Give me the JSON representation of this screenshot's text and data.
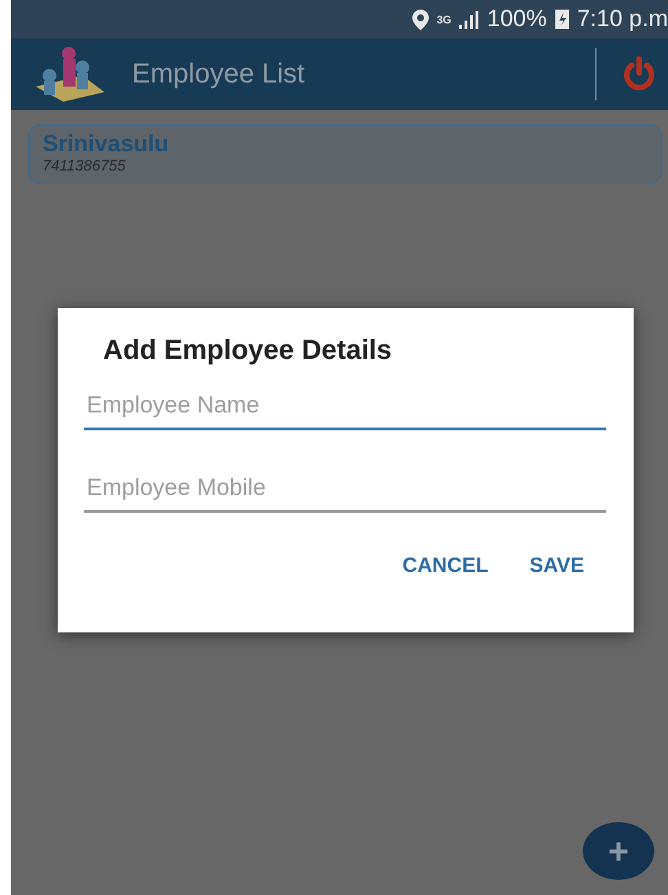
{
  "status_bar": {
    "network": "3G",
    "battery": "100%",
    "time": "7:10 p.m"
  },
  "app_bar": {
    "title": "Employee List"
  },
  "employees": [
    {
      "name": "Srinivasulu",
      "mobile": "7411386755"
    }
  ],
  "dialog": {
    "title": "Add Employee Details",
    "fields": [
      {
        "placeholder": "Employee Name",
        "focused": true
      },
      {
        "placeholder": "Employee Mobile",
        "focused": false
      }
    ],
    "buttons": [
      "CANCEL",
      "SAVE"
    ]
  },
  "fab": {
    "label": "+"
  }
}
